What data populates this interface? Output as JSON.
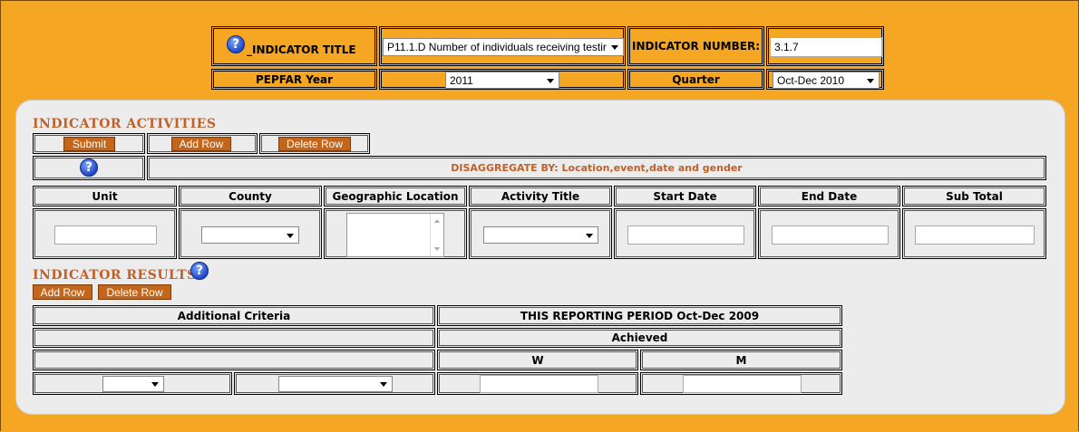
{
  "header": {
    "indicator_title_label": "_INDICATOR TITLE",
    "indicator_title_value": "P11.1.D Number of individuals receiving testir",
    "indicator_number_label": "INDICATOR NUMBER:",
    "indicator_number_value": "3.1.7",
    "pepfar_year_label": "PEPFAR Year",
    "pepfar_year_value": "2011",
    "quarter_label": "Quarter",
    "quarter_value": "Oct-Dec 2010",
    "help_glyph": "?"
  },
  "activities": {
    "title": "INDICATOR ACTIVITIES",
    "submit_label": "Submit",
    "add_row_label": "Add Row",
    "delete_row_label": "Delete Row",
    "disaggregate_text": "DISAGGREGATE BY: Location,event,date and gender",
    "columns": [
      "Unit",
      "County",
      "Geographic Location",
      "Activity Title",
      "Start Date",
      "End Date",
      "Sub Total"
    ]
  },
  "results": {
    "title": "INDICATOR RESULTS",
    "add_row_label": "Add Row",
    "delete_row_label": "Delete Row",
    "additional_criteria": "Additional Criteria",
    "period_header": "THIS REPORTING PERIOD Oct-Dec 2009",
    "achieved": "Achieved",
    "w": "W",
    "m": "M"
  },
  "colors": {
    "background": "#f5a623",
    "panel": "#ececec",
    "button": "#c3651a",
    "section_title": "#c0602a",
    "help_icon": "#1f48c9"
  },
  "icons": [
    "help-icon",
    "dropdown-arrow-icon"
  ]
}
